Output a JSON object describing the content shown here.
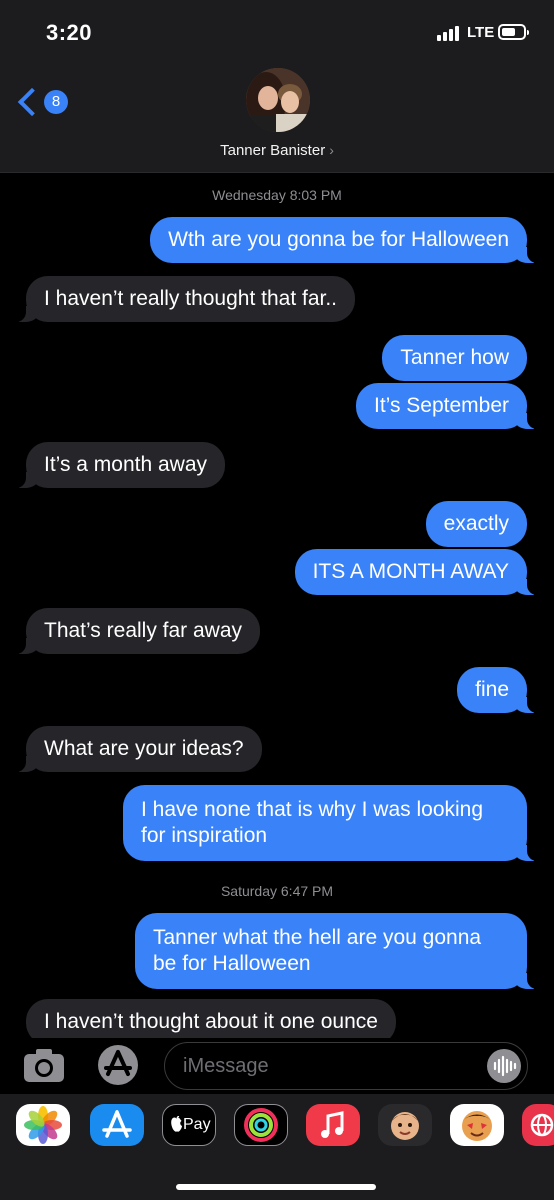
{
  "status": {
    "time": "3:20",
    "network": "LTE"
  },
  "header": {
    "back_badge": "8",
    "contact_name": "Tanner Banister",
    "contact_chevron": "›"
  },
  "thread": {
    "timestamps": [
      "Wednesday 8:03 PM",
      "Saturday 6:47 PM"
    ],
    "messages": [
      {
        "from": "me",
        "text": "Wth are you gonna be for Halloween"
      },
      {
        "from": "them",
        "text": "I haven’t really thought that far.."
      },
      {
        "from": "me",
        "text": "Tanner how"
      },
      {
        "from": "me",
        "text": "It’s September"
      },
      {
        "from": "them",
        "text": "It’s a month away"
      },
      {
        "from": "me",
        "text": "exactly"
      },
      {
        "from": "me",
        "text": "ITS A MONTH AWAY"
      },
      {
        "from": "them",
        "text": "That’s really far away"
      },
      {
        "from": "me",
        "text": "fine"
      },
      {
        "from": "them",
        "text": "What are your ideas?"
      },
      {
        "from": "me",
        "text": "I have none that is why I was looking for inspiration"
      },
      {
        "from": "me",
        "text": "Tanner what the hell are you gonna be for Halloween"
      },
      {
        "from": "them",
        "text": "I haven’t thought about it one ounce"
      }
    ]
  },
  "compose": {
    "placeholder": "iMessage"
  },
  "dock": {
    "apps": [
      "photos-icon",
      "app-store-icon",
      "apple-pay-icon",
      "activity-icon",
      "music-icon",
      "memoji-icon",
      "animoji-icon",
      "web-icon"
    ],
    "apple_pay_label": "Pay"
  },
  "colors": {
    "sent_bubble": "#3a82f7",
    "received_bubble": "#26252a",
    "background": "#000000"
  }
}
